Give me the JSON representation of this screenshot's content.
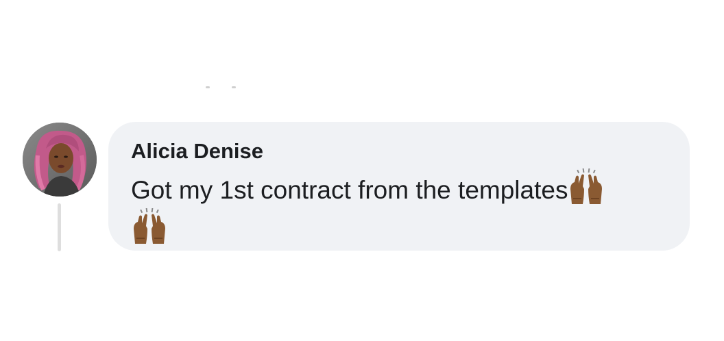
{
  "comment": {
    "author": "Alicia Denise",
    "text": "Got my 1st contract from the templates",
    "reactions": [
      "raising-hands-emoji",
      "raising-hands-emoji"
    ],
    "avatar": "profile-photo"
  },
  "colors": {
    "bubble_background": "#f0f2f5",
    "text": "#1c1e21",
    "thread_line": "#dedede",
    "emoji_skin": "#8a5a32"
  }
}
